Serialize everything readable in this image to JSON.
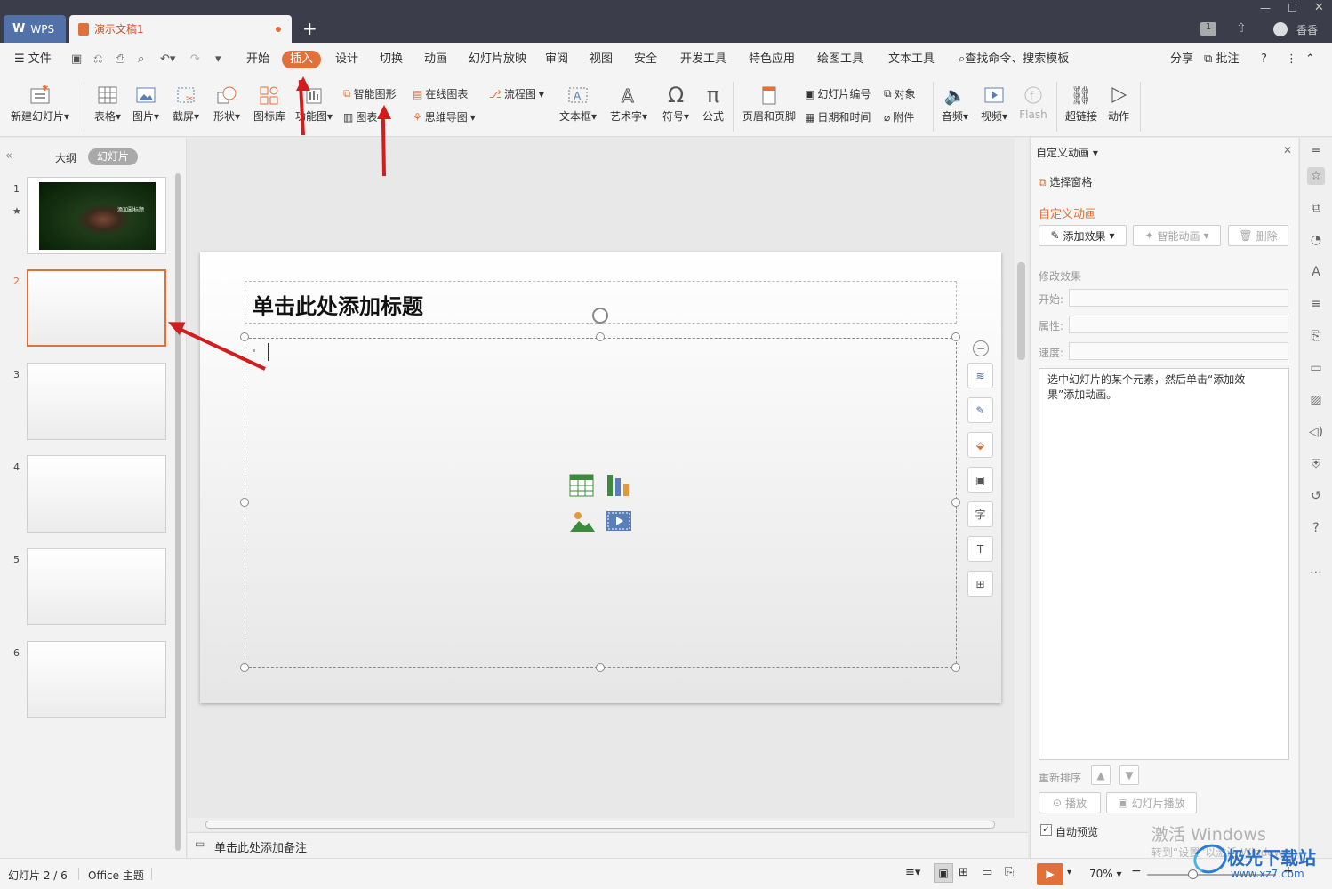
{
  "titlebar": {
    "wps_label": "WPS",
    "doc_title": "演示文稿1",
    "new_tab": "+",
    "user_name": "香香",
    "badge": "1"
  },
  "menu": {
    "items": [
      "文件",
      "开始",
      "插入",
      "设计",
      "切换",
      "动画",
      "幻灯片放映",
      "审阅",
      "视图",
      "安全",
      "开发工具",
      "特色应用",
      "绘图工具",
      "文本工具"
    ],
    "search": "查找命令、搜索模板",
    "share": "分享",
    "comment": "批注",
    "help": "?"
  },
  "ribbon": {
    "new_slide": "新建幻灯片",
    "table": "表格",
    "picture": "图片",
    "screenshot": "截屏",
    "shape": "形状",
    "icon_lib": "图标库",
    "func_chart": "功能图",
    "smart_shape": "智能图形",
    "chart": "图表",
    "online_chart": "在线图表",
    "flowchart": "流程图",
    "mindmap": "思维导图",
    "textbox": "文本框",
    "wordart": "艺术字",
    "symbol": "符号",
    "formula": "公式",
    "header_footer": "页眉和页脚",
    "slide_number": "幻灯片编号",
    "object": "对象",
    "datetime": "日期和时间",
    "attachment": "附件",
    "audio": "音频",
    "video": "视频",
    "flash": "Flash",
    "hyperlink": "超链接",
    "action": "动作"
  },
  "leftpanel": {
    "tab_outline": "大纲",
    "tab_slides": "幻灯片",
    "slide_numbers": [
      "1",
      "2",
      "3",
      "4",
      "5",
      "6"
    ],
    "thumb1_caption": "添加副标题"
  },
  "slide": {
    "title_placeholder": "单击此处添加标题",
    "notes_placeholder": "单击此处添加备注"
  },
  "animpanel": {
    "header": "自定义动画",
    "select_pane": "选择窗格",
    "section_title": "自定义动画",
    "add_effect": "添加效果",
    "smart_anim": "智能动画",
    "delete": "删除",
    "modify_title": "修改效果",
    "start_label": "开始:",
    "property_label": "属性:",
    "speed_label": "速度:",
    "hint": "选中幻灯片的某个元素，然后单击“添加效果”添加动画。",
    "reorder": "重新排序",
    "play": "播放",
    "slideshow": "幻灯片播放",
    "auto_preview": "自动预览"
  },
  "statusbar": {
    "slide_info": "幻灯片 2 / 6",
    "theme": "Office 主题",
    "zoom": "70%"
  },
  "watermark": {
    "activate": "激活 Windows",
    "goto": "转到“设置”以激活 Windows。",
    "brand": "极光下载站",
    "url": "www.xz7.com"
  },
  "colors": {
    "accent": "#e0713a",
    "titlebar": "#3b3e4a",
    "arrow": "#d01e1e",
    "wps_blue": "#5271a8"
  }
}
